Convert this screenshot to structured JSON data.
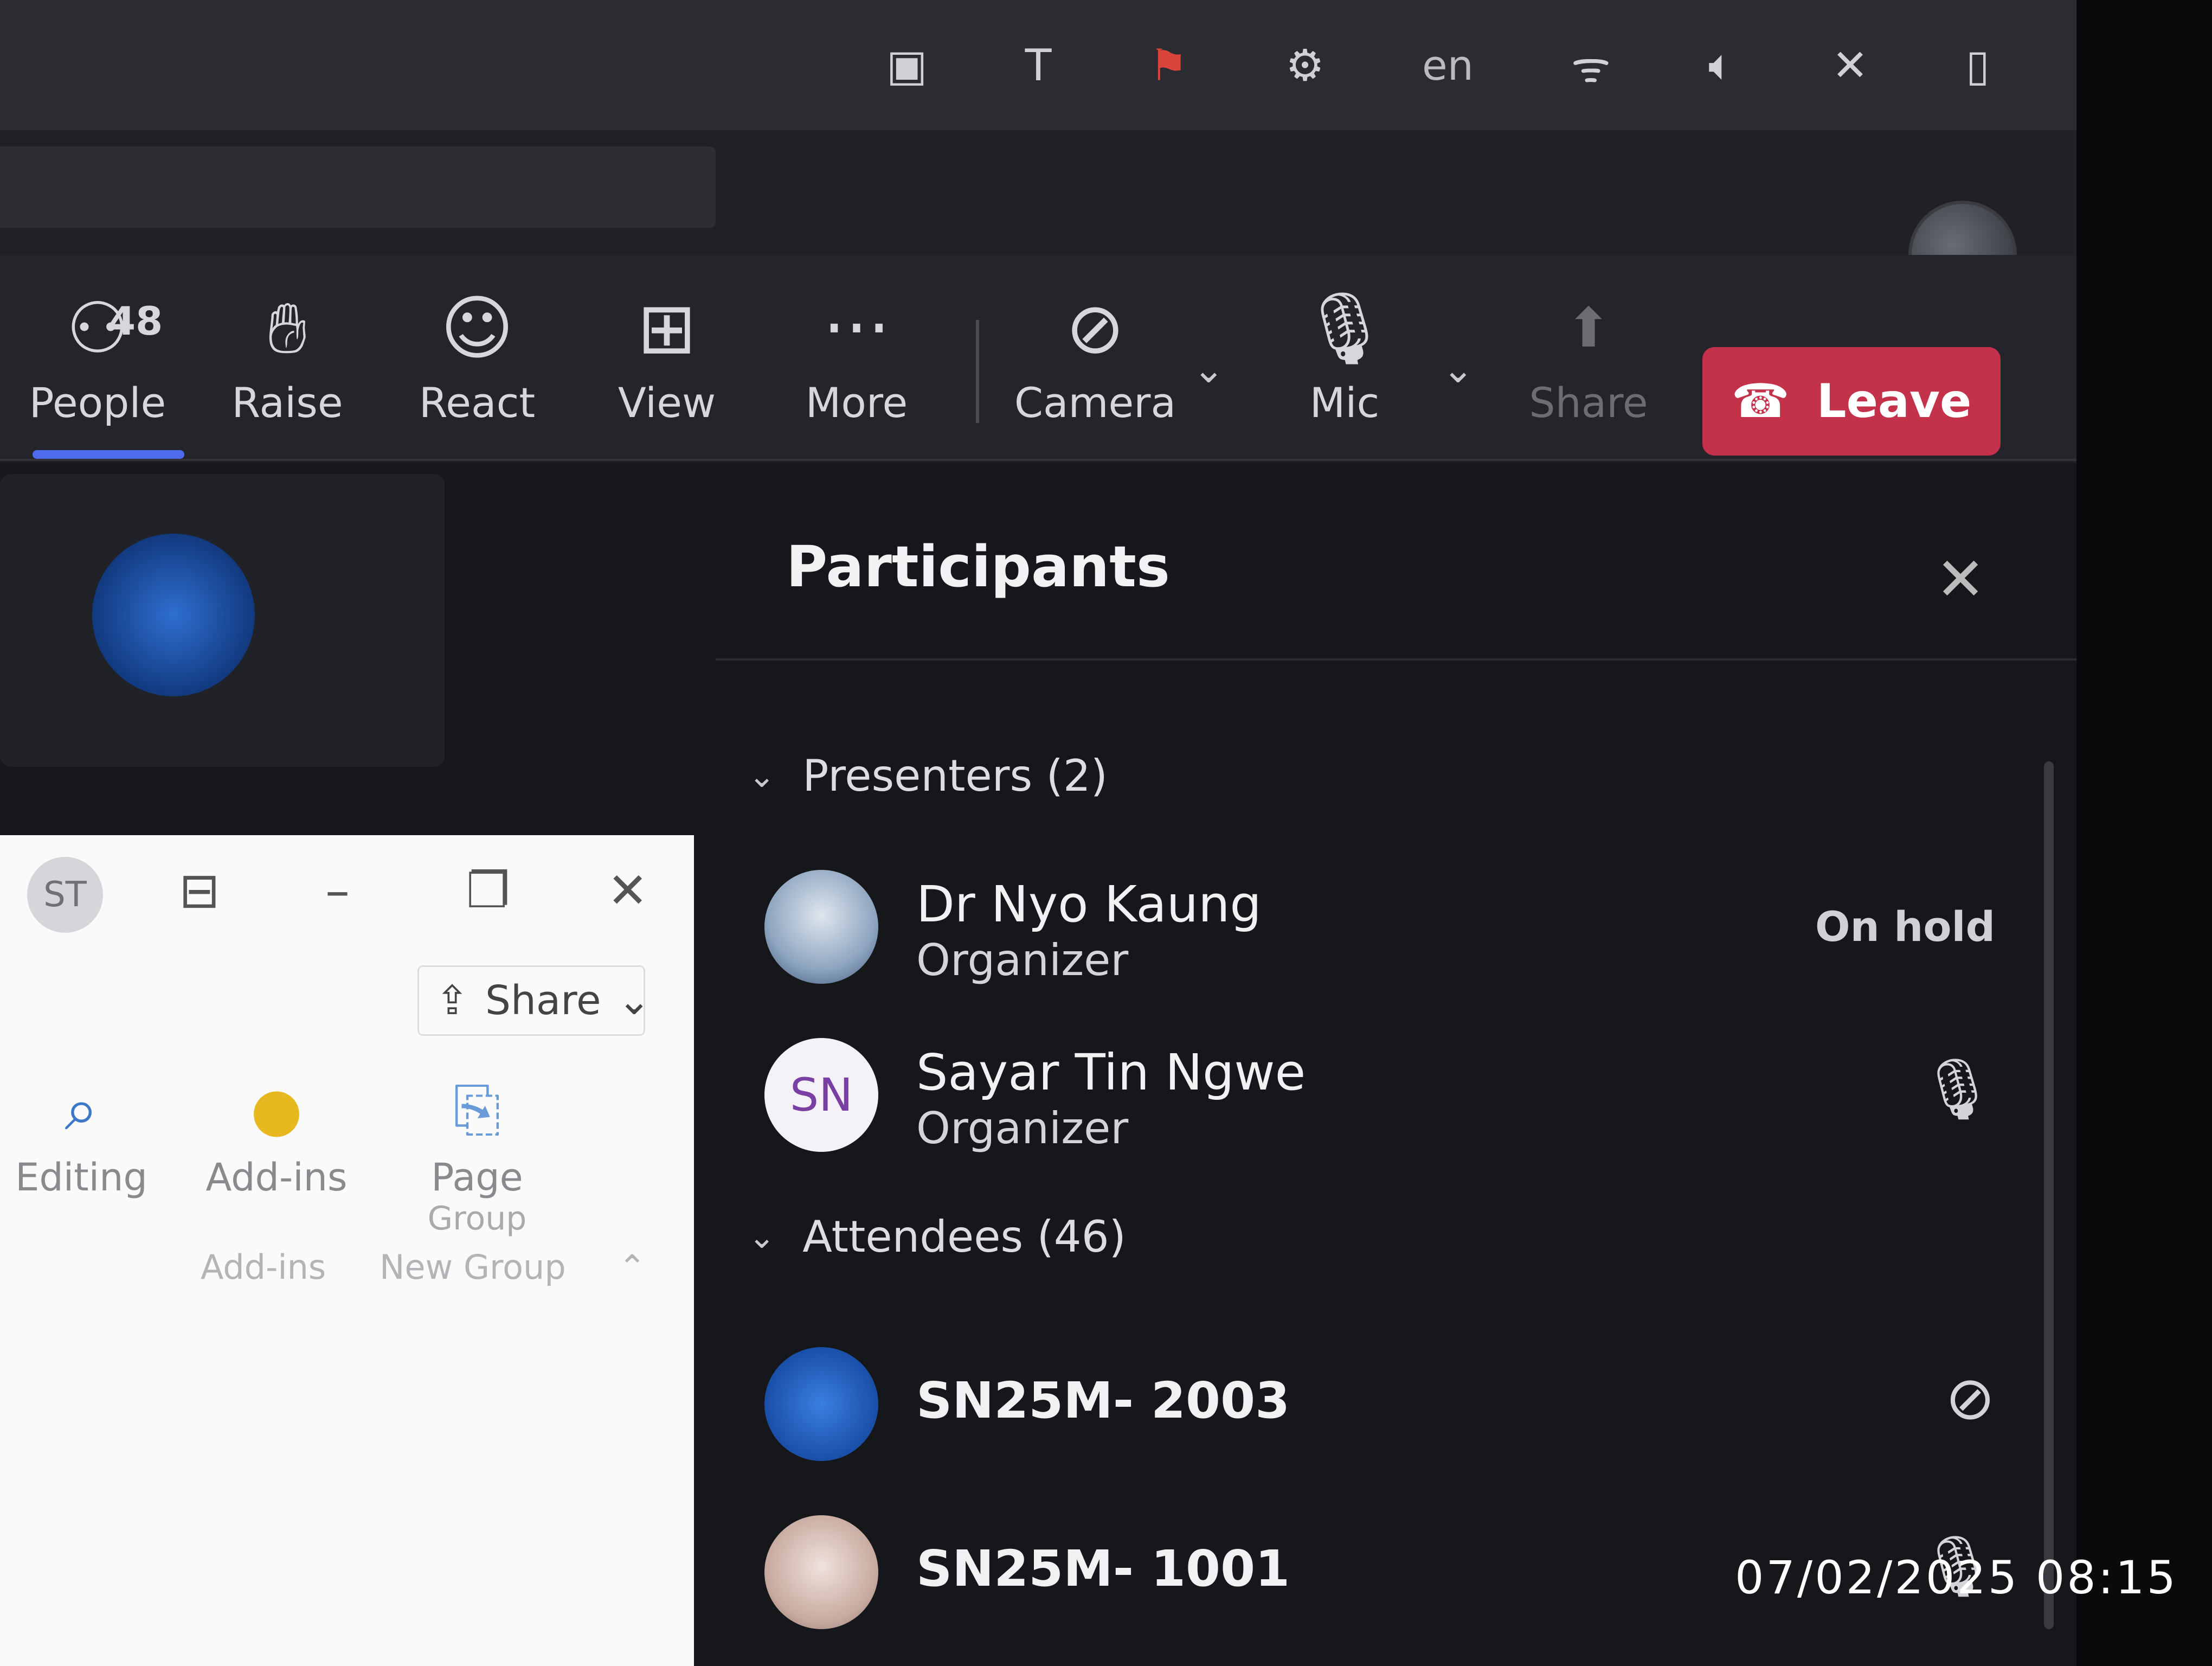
{
  "tray": {
    "icons": [
      "teams-icon",
      "teams-badge-icon",
      "flag-icon",
      "gear-icon",
      "wifi-icon",
      "volume-icon",
      "mic-off-icon",
      "battery-icon"
    ],
    "language": "en"
  },
  "toolbar": {
    "people_count": "48",
    "people_label": "People",
    "raise_label": "Raise",
    "react_label": "React",
    "view_label": "View",
    "more_label": "More",
    "camera_label": "Camera",
    "mic_label": "Mic",
    "share_label": "Share",
    "leave_label": "Leave"
  },
  "word": {
    "avatar_initials": "ST",
    "share_label": "Share",
    "ribbon": [
      {
        "label": "Editing",
        "icon": "search-icon"
      },
      {
        "label": "Add-ins",
        "icon": "add-ins-icon"
      },
      {
        "label": "Page",
        "sub": "Group",
        "icon": "page-group-icon"
      }
    ],
    "group_labels": [
      "Add-ins",
      "New Group"
    ]
  },
  "participants": {
    "title": "Participants",
    "presenters_header": "Presenters (2)",
    "attendees_header": "Attendees (46)",
    "presenters": [
      {
        "name": "Dr Nyo Kaung",
        "role": "Organizer",
        "status": "On hold",
        "avatar": "photo"
      },
      {
        "name": "Sayar Tin Ngwe",
        "role": "Organizer",
        "initials": "SN",
        "mic": "mic-on"
      }
    ],
    "attendees": [
      {
        "name": "SN25M- 2003",
        "mic": "mic-off"
      },
      {
        "name": "SN25M- 1001",
        "mic": "mic-on"
      }
    ]
  },
  "photo_timestamp": "07/02/2025 08:15",
  "colors": {
    "leave": "#c4314b",
    "active_tab": "#4f6bed",
    "panel_bg": "#16171b"
  }
}
